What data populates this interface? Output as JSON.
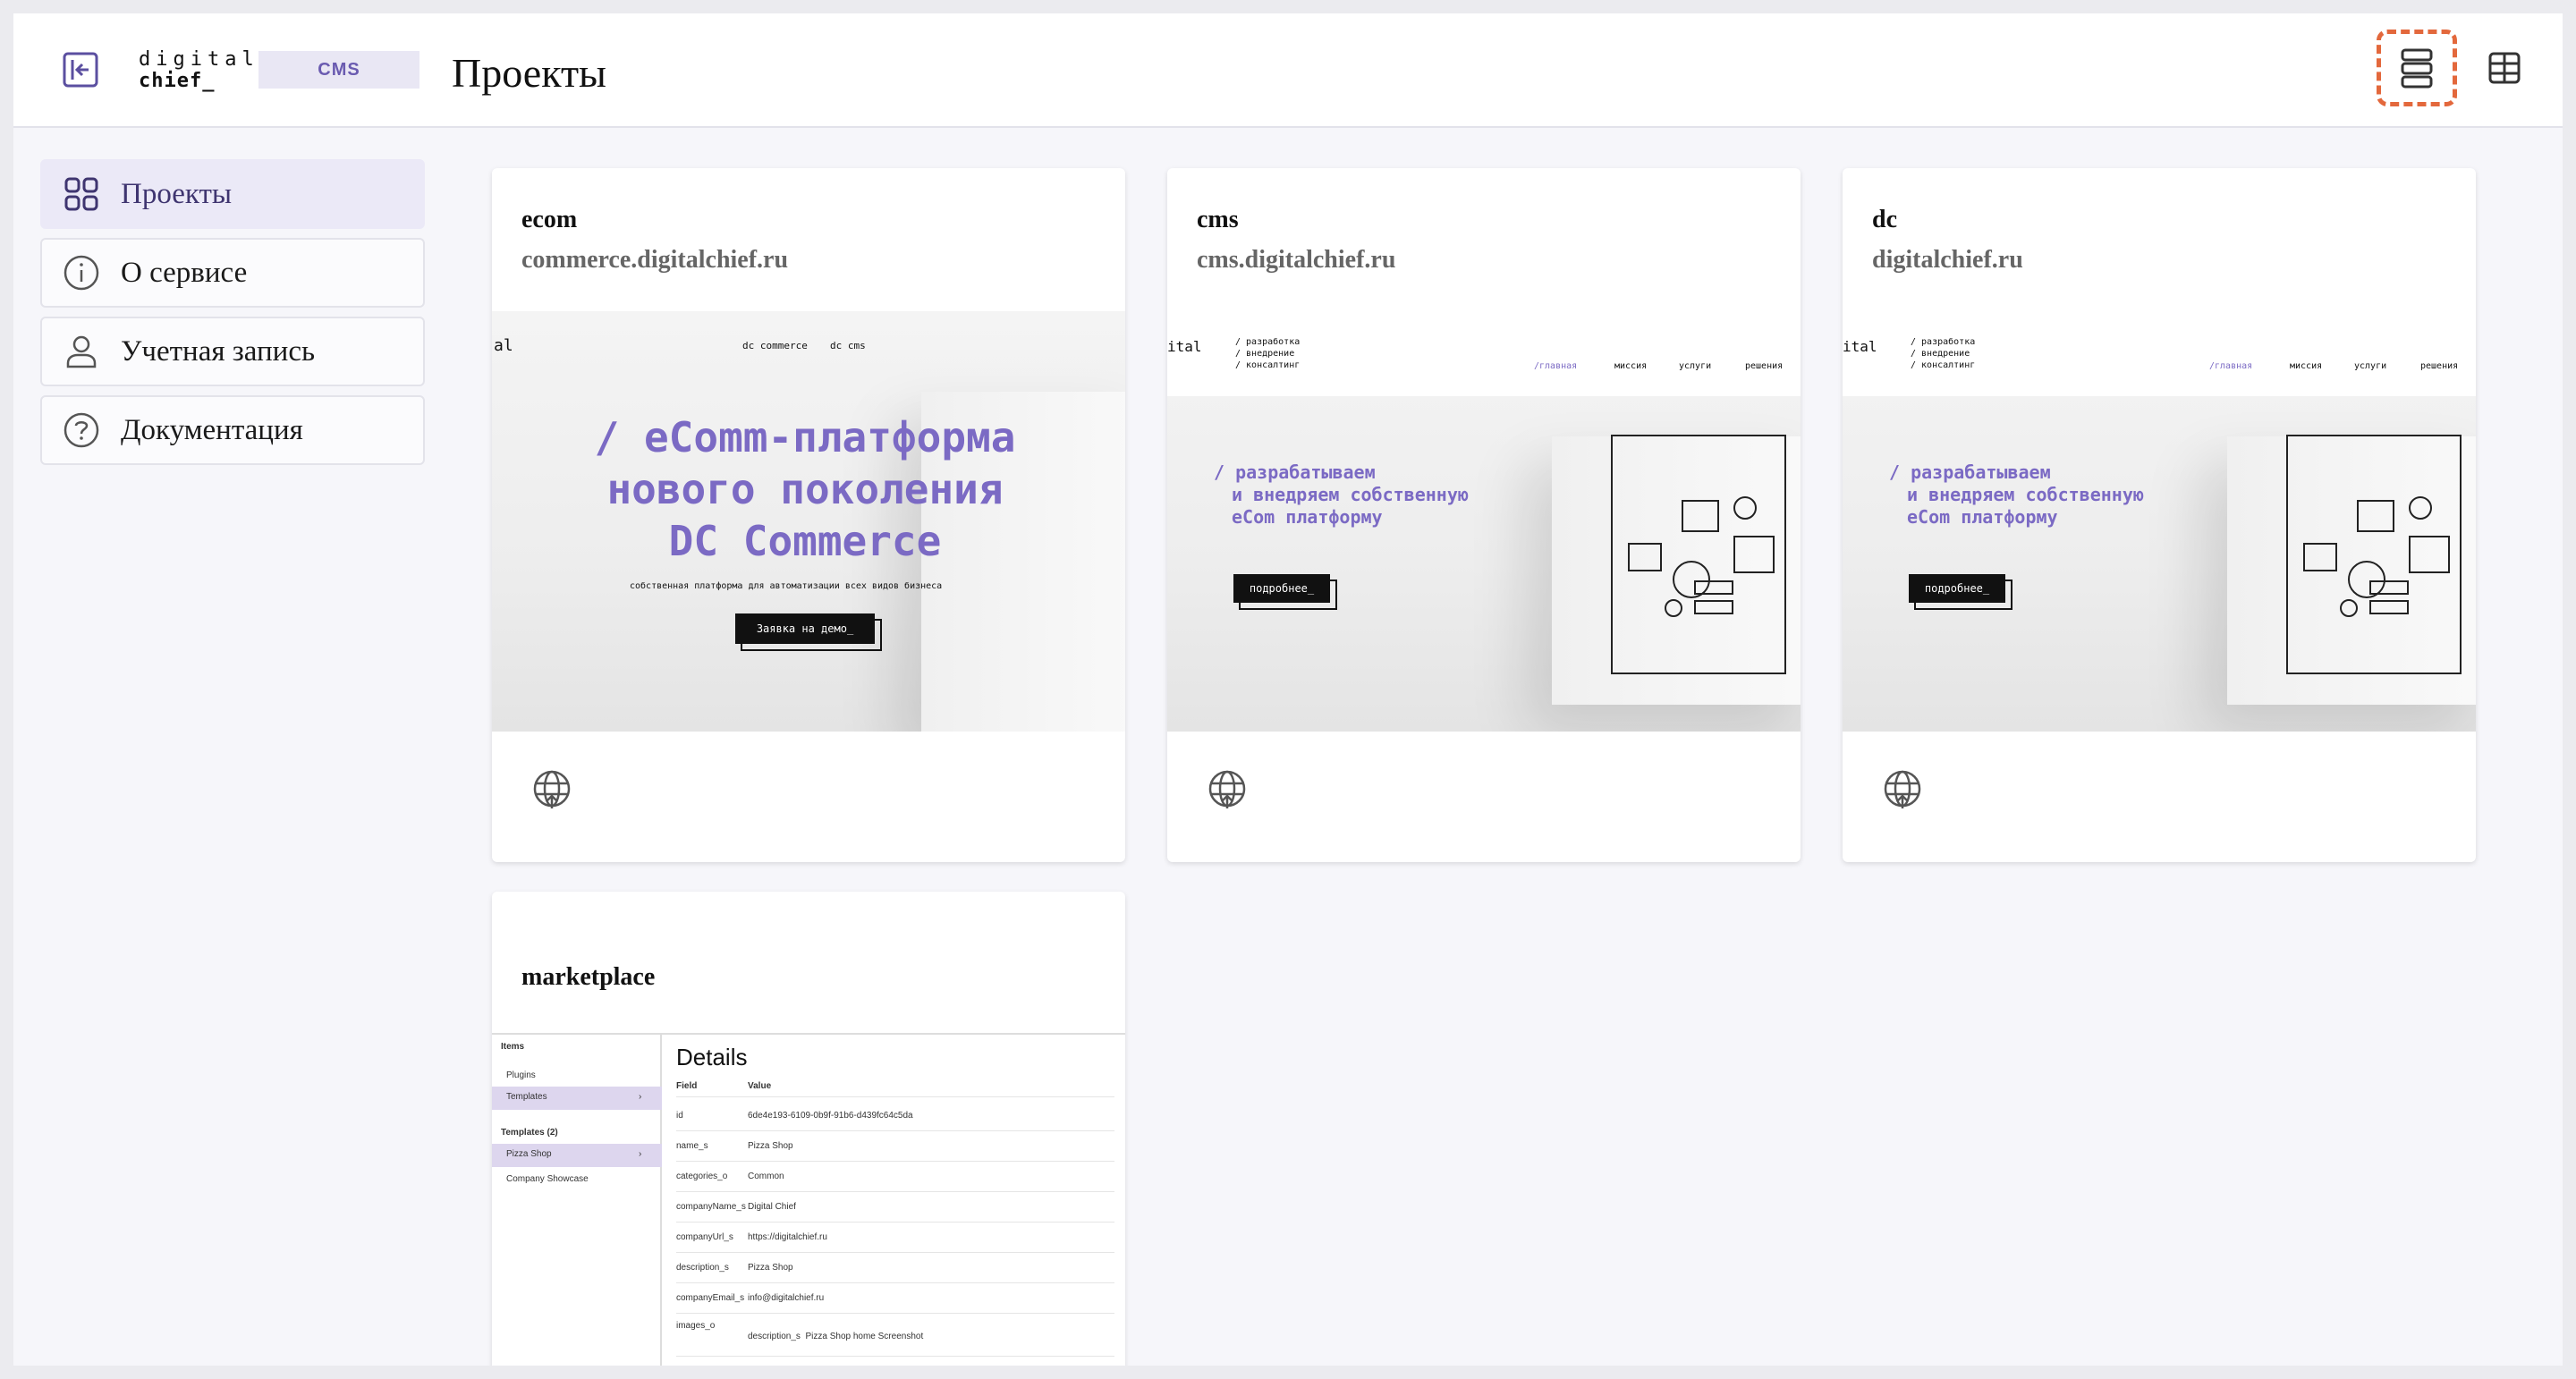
{
  "header": {
    "logo_line1": "digital",
    "logo_line2": "chief_",
    "badge": "CMS",
    "title": "Проекты"
  },
  "sidebar": {
    "items": [
      {
        "label": "Проекты",
        "icon": "grid-icon",
        "active": true
      },
      {
        "label": "О сервисе",
        "icon": "info-icon"
      },
      {
        "label": "Учетная запись",
        "icon": "user-icon"
      },
      {
        "label": "Документация",
        "icon": "help-icon"
      }
    ]
  },
  "projects": [
    {
      "name": "ecom",
      "url": "commerce.digitalchief.ru",
      "preview": {
        "logo": "al",
        "menu": [
          "dc commerce",
          "dc cms"
        ],
        "headline": [
          "/ eComm-платформа",
          "нового поколения",
          "DC Commerce"
        ],
        "subtitle": "собственная платформа для автоматизации всех видов бизнеса",
        "button": "Заявка на демо_"
      }
    },
    {
      "name": "cms",
      "url": "cms.digitalchief.ru",
      "preview": {
        "logo": "ital",
        "tagline": [
          "/ разработка",
          "/ внедрение",
          "/ консалтинг"
        ],
        "menu": [
          "/главная",
          "миссия",
          "услуги",
          "решения"
        ],
        "headline": [
          "/ разрабатываем",
          "и внедряем собственную",
          "eCom платформу"
        ],
        "button": "подробнее_"
      }
    },
    {
      "name": "dc",
      "url": "digitalchief.ru",
      "preview": {
        "logo": "ital",
        "tagline": [
          "/ разработка",
          "/ внедрение",
          "/ консалтинг"
        ],
        "menu": [
          "/главная",
          "миссия",
          "услуги",
          "решения"
        ],
        "headline": [
          "/ разрабатываем",
          "и внедряем собственную",
          "eCom платформу"
        ],
        "button": "подробнее_"
      }
    },
    {
      "name": "marketplace",
      "preview": {
        "side_items_title": "Items",
        "side_items": [
          "Plugins",
          "Templates"
        ],
        "templates_title": "Templates (2)",
        "templates": [
          "Pizza Shop",
          "Company Showcase"
        ],
        "details_title": "Details",
        "col_field": "Field",
        "col_value": "Value",
        "rows": [
          {
            "k": "id",
            "v": "6de4e193-6109-0b9f-91b6-d439fc64c5da"
          },
          {
            "k": "name_s",
            "v": "Pizza Shop"
          },
          {
            "k": "categories_o",
            "v": "Common"
          },
          {
            "k": "companyName_s",
            "v": "Digital Chief"
          },
          {
            "k": "companyUrl_s",
            "v": "https://digitalchief.ru"
          },
          {
            "k": "description_s",
            "v": "Pizza Shop"
          },
          {
            "k": "companyEmail_s",
            "v": "info@digitalchief.ru"
          },
          {
            "k": "images_o",
            "v": ""
          }
        ],
        "nested_key": "description_s",
        "nested_value": "Pizza Shop home Screenshot"
      }
    }
  ],
  "colors": {
    "accent": "#6a5bb0",
    "highlight": "#e3683c",
    "preview_purple": "#7b6ac4"
  }
}
